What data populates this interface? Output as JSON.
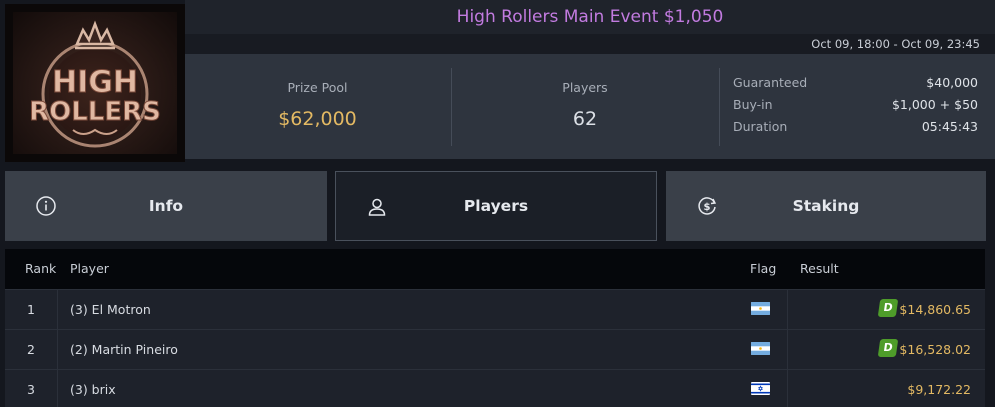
{
  "event": {
    "title": "High Rollers Main Event $1,050",
    "dates": "Oct 09, 18:00 - Oct 09, 23:45",
    "logo": {
      "line1": "HIGH",
      "line2": "ROLLERS"
    }
  },
  "stats": {
    "prize_pool_label": "Prize Pool",
    "prize_pool_value": "$62,000",
    "players_label": "Players",
    "players_value": "62",
    "details": [
      {
        "key": "Guaranteed",
        "value": "$40,000"
      },
      {
        "key": "Buy-in",
        "value": "$1,000 + $50"
      },
      {
        "key": "Duration",
        "value": "05:45:43"
      }
    ]
  },
  "tabs": [
    {
      "label": "Info",
      "icon": "info-icon",
      "active": false
    },
    {
      "label": "Players",
      "icon": "user-icon",
      "active": true
    },
    {
      "label": "Staking",
      "icon": "dollar-coin-icon",
      "active": false
    }
  ],
  "table": {
    "headers": {
      "rank": "Rank",
      "player": "Player",
      "flag": "Flag",
      "result": "Result"
    },
    "rows": [
      {
        "rank": "1",
        "player": "(3) El Motron",
        "flag": "argentina-flag",
        "badge": "D",
        "result": "$14,860.65"
      },
      {
        "rank": "2",
        "player": "(2) Martin Pineiro",
        "flag": "argentina-flag",
        "badge": "D",
        "result": "$16,528.02"
      },
      {
        "rank": "3",
        "player": "(3) brix",
        "flag": "israel-flag",
        "badge": "",
        "result": "$9,172.22"
      }
    ]
  },
  "colors": {
    "title": "#c27be0",
    "prize": "#e3b963",
    "result": "#e3b963",
    "badge": "#4e9c2a"
  }
}
